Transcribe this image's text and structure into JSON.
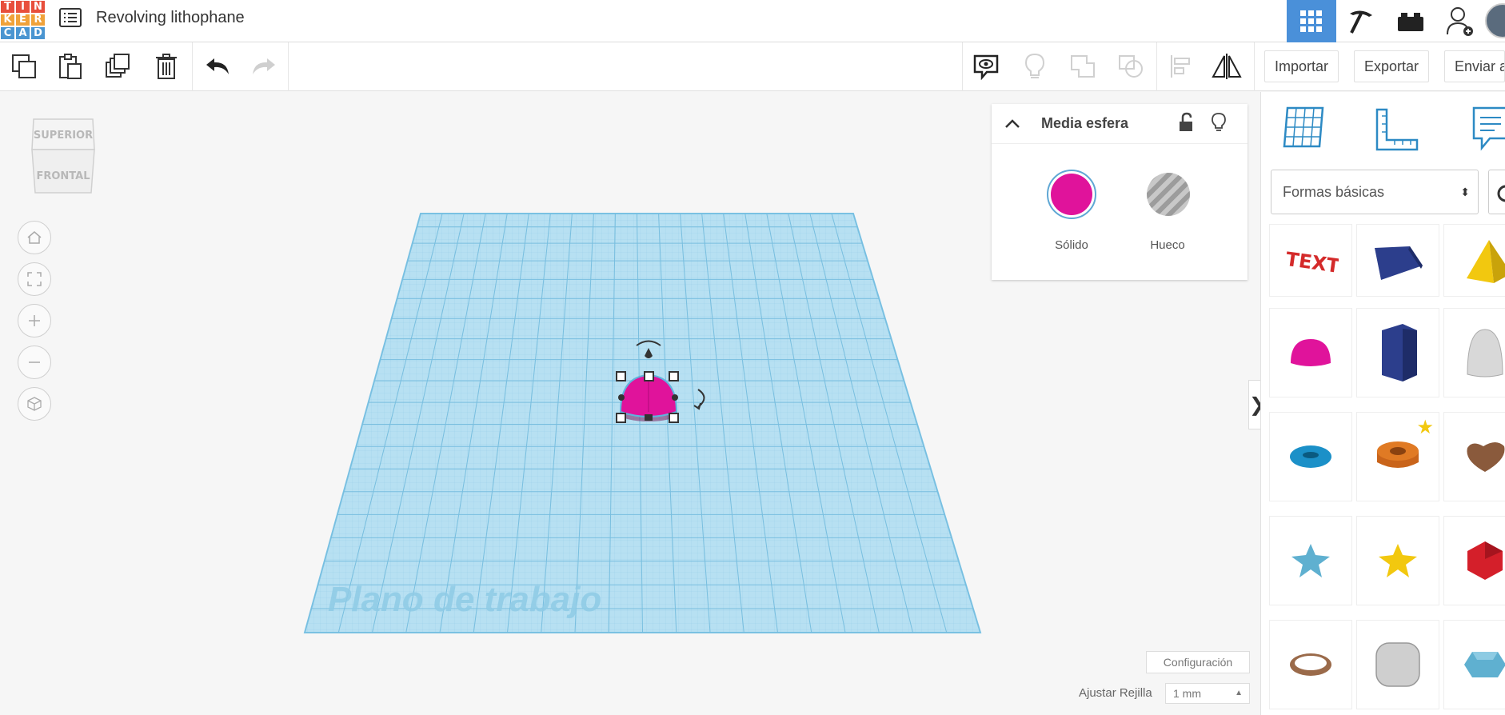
{
  "app": {
    "logo_letters": [
      "T",
      "I",
      "N",
      "K",
      "E",
      "R",
      "C",
      "A",
      "D"
    ],
    "project_title": "Revolving lithophane"
  },
  "header_icons": [
    "menu-icon",
    "grid-view-icon",
    "pickaxe-icon",
    "bricks-icon",
    "add-user-icon",
    "avatar"
  ],
  "toolbar": {
    "tools": [
      "copy-icon",
      "paste-icon",
      "duplicate-icon",
      "delete-icon",
      "undo-icon",
      "redo-icon"
    ],
    "view_tools": [
      "notes-icon",
      "light-icon",
      "group-icon",
      "ungroup-icon",
      "align-icon",
      "mirror-icon"
    ],
    "import_label": "Importar",
    "export_label": "Exportar",
    "send_label": "Enviar a"
  },
  "viewcube": {
    "top_label": "SUPERIOR",
    "front_label": "FRONTAL"
  },
  "workplane": {
    "label": "Plano de trabajo"
  },
  "inspector": {
    "title": "Media esfera",
    "solid_label": "Sólido",
    "hole_label": "Hueco",
    "solid_color": "#e0139b"
  },
  "settings": {
    "config_label": "Configuración",
    "snap_label": "Ajustar Rejilla",
    "snap_value": "1 mm"
  },
  "shapes_panel": {
    "category": "Formas básicas",
    "shapes": [
      {
        "name": "text-shape",
        "color": "#d42a2a"
      },
      {
        "name": "wedge-shape",
        "color": "#2c3e8c"
      },
      {
        "name": "pyramid-shape",
        "color": "#f2c80f"
      },
      {
        "name": "half-sphere-shape",
        "color": "#e0139b"
      },
      {
        "name": "polygon-shape",
        "color": "#2c3e8c"
      },
      {
        "name": "paraboloid-shape",
        "color": "#d8d8d8"
      },
      {
        "name": "torus-shape",
        "color": "#1b90c8"
      },
      {
        "name": "tube-shape",
        "color": "#e07a24"
      },
      {
        "name": "heart-shape",
        "color": "#8a5a3c"
      },
      {
        "name": "star-shape",
        "color": "#5fb0d0"
      },
      {
        "name": "star-yellow-shape",
        "color": "#f2c80f"
      },
      {
        "name": "icosahedron-shape",
        "color": "#d41f2a"
      },
      {
        "name": "ring-shape",
        "color": "#9a6a4a"
      },
      {
        "name": "rounded-box-shape",
        "color": "#cfcfcf"
      },
      {
        "name": "gem-shape",
        "color": "#5fb0d0"
      }
    ]
  },
  "colors": {
    "accent": "#4a90d9",
    "workplane": "#a9d8ee"
  }
}
